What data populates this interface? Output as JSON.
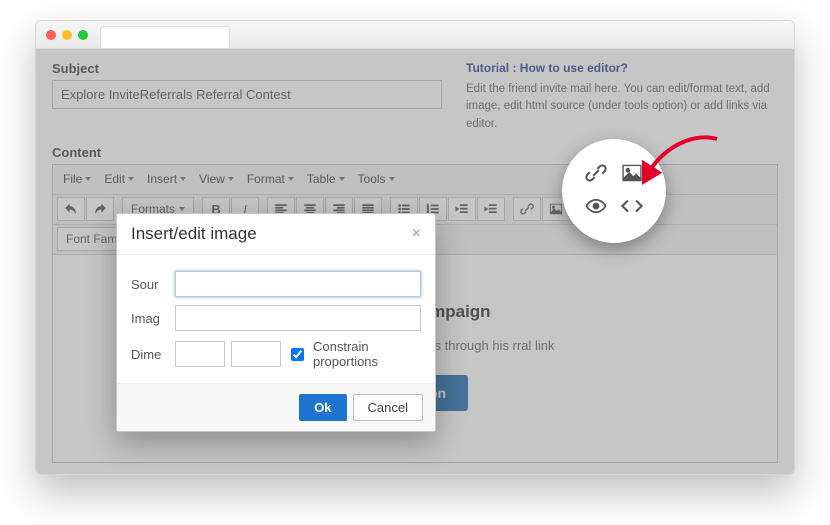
{
  "subject": {
    "label": "Subject",
    "value": "Explore InviteReferrals Referral Contest"
  },
  "right_panel": {
    "tutorial_link": "Tutorial : How to use editor?",
    "help_text": "Edit the friend invite mail here. You can edit/format text, add image, edit html source (under tools option) or add links via editor."
  },
  "content_label": "Content",
  "menubar": {
    "file": "File",
    "edit": "Edit",
    "insert": "Insert",
    "view": "View",
    "format": "Format",
    "table": "Table",
    "tools": "Tools"
  },
  "toolbar": {
    "formats": "Formats",
    "font_family": "Font Family"
  },
  "canvas": {
    "title": "Referral Campaign",
    "body_line": "ited you to try InviteReferrals through his rral link",
    "button": "Invitation"
  },
  "modal": {
    "title": "Insert/edit image",
    "source_label": "Sour",
    "image_label": "Imag",
    "dimensions_label": "Dime",
    "constrain": "Constrain proportions",
    "ok": "Ok",
    "cancel": "Cancel"
  }
}
